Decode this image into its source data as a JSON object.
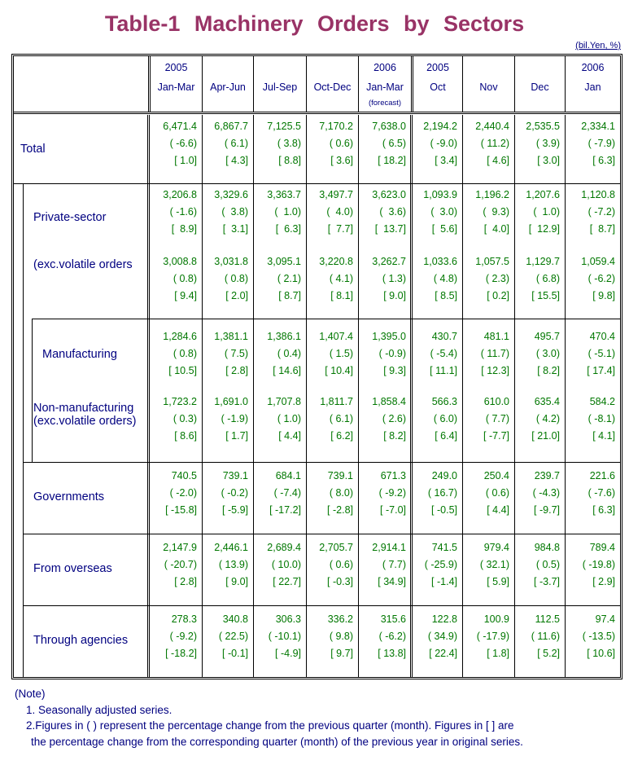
{
  "title": "Table-1  Machinery  Orders  by  Sectors",
  "unit": "(bil.Yen, %)",
  "columns": [
    {
      "year": "2005",
      "period": "Jan-Mar",
      "note": ""
    },
    {
      "year": "",
      "period": "Apr-Jun",
      "note": ""
    },
    {
      "year": "",
      "period": "Jul-Sep",
      "note": ""
    },
    {
      "year": "",
      "period": "Oct-Dec",
      "note": ""
    },
    {
      "year": "2006",
      "period": "Jan-Mar",
      "note": "(forecast)"
    },
    {
      "year": "2005",
      "period": "Oct",
      "note": ""
    },
    {
      "year": "",
      "period": "Nov",
      "note": ""
    },
    {
      "year": "",
      "period": "Dec",
      "note": ""
    },
    {
      "year": "2006",
      "period": "Jan",
      "note": ""
    }
  ],
  "rows": [
    {
      "label": "Total",
      "values": [
        "6,471.4",
        "6,867.7",
        "7,125.5",
        "7,170.2",
        "7,638.0",
        "2,194.2",
        "2,440.4",
        "2,535.5",
        "2,334.1"
      ],
      "qoq": [
        "( -6.6)",
        "( 6.1)",
        "( 3.8)",
        "( 0.6)",
        "( 6.5)",
        "( -9.0)",
        "( 11.2)",
        "( 3.9)",
        "( -7.9)"
      ],
      "yoy": [
        "[ 1.0]",
        "[ 4.3]",
        "[ 8.8]",
        "[ 3.6]",
        "[ 18.2]",
        "[ 3.4]",
        "[ 4.6]",
        "[ 3.0]",
        "[ 6.3]"
      ]
    },
    {
      "label": "Private-sector",
      "values": [
        "3,206.8",
        "3,329.6",
        "3,363.7",
        "3,497.7",
        "3,623.0",
        "1,093.9",
        "1,196.2",
        "1,207.6",
        "1,120.8"
      ],
      "qoq": [
        "( -1.6)",
        "(  3.8)",
        "(  1.0)",
        "(  4.0)",
        "(  3.6)",
        "(  3.0)",
        "(  9.3)",
        "(  1.0)",
        "( -7.2)"
      ],
      "yoy": [
        "[  8.9]",
        "[  3.1]",
        "[  6.3]",
        "[  7.7]",
        "[  13.7]",
        "[  5.6]",
        "[  4.0]",
        "[  12.9]",
        "[  8.7]"
      ]
    },
    {
      "label": "(exc.volatile orders",
      "values": [
        "3,008.8",
        "3,031.8",
        "3,095.1",
        "3,220.8",
        "3,262.7",
        "1,033.6",
        "1,057.5",
        "1,129.7",
        "1,059.4"
      ],
      "qoq": [
        "( 0.8)",
        "( 0.8)",
        "( 2.1)",
        "( 4.1)",
        "( 1.3)",
        "( 4.8)",
        "( 2.3)",
        "( 6.8)",
        "( -6.2)"
      ],
      "yoy": [
        "[ 9.4]",
        "[ 2.0]",
        "[ 8.7]",
        "[ 8.1]",
        "[ 9.0]",
        "[ 8.5]",
        "[ 0.2]",
        "[ 15.5]",
        "[ 9.8]"
      ]
    },
    {
      "label": "Manufacturing",
      "values": [
        "1,284.6",
        "1,381.1",
        "1,386.1",
        "1,407.4",
        "1,395.0",
        "430.7",
        "481.1",
        "495.7",
        "470.4"
      ],
      "qoq": [
        "( 0.8)",
        "( 7.5)",
        "( 0.4)",
        "( 1.5)",
        "( -0.9)",
        "( -5.4)",
        "( 11.7)",
        "( 3.0)",
        "( -5.1)"
      ],
      "yoy": [
        "[ 10.5]",
        "[ 2.8]",
        "[ 14.6]",
        "[ 10.4]",
        "[ 9.3]",
        "[ 11.1]",
        "[ 12.3]",
        "[ 8.2]",
        "[ 17.4]"
      ]
    },
    {
      "label": "Non-manufacturing",
      "label2": "(exc.volatile orders)",
      "values": [
        "1,723.2",
        "1,691.0",
        "1,707.8",
        "1,811.7",
        "1,858.4",
        "566.3",
        "610.0",
        "635.4",
        "584.2"
      ],
      "qoq": [
        "( 0.3)",
        "( -1.9)",
        "( 1.0)",
        "( 6.1)",
        "( 2.6)",
        "( 6.0)",
        "( 7.7)",
        "( 4.2)",
        "( -8.1)"
      ],
      "yoy": [
        "[ 8.6]",
        "[ 1.7]",
        "[ 4.4]",
        "[ 6.2]",
        "[ 8.2]",
        "[ 6.4]",
        "[ -7.7]",
        "[ 21.0]",
        "[ 4.1]"
      ]
    },
    {
      "label": "Governments",
      "values": [
        "740.5",
        "739.1",
        "684.1",
        "739.1",
        "671.3",
        "249.0",
        "250.4",
        "239.7",
        "221.6"
      ],
      "qoq": [
        "( -2.0)",
        "( -0.2)",
        "( -7.4)",
        "( 8.0)",
        "( -9.2)",
        "( 16.7)",
        "( 0.6)",
        "( -4.3)",
        "( -7.6)"
      ],
      "yoy": [
        "[ -15.8]",
        "[ -5.9]",
        "[ -17.2]",
        "[ -2.8]",
        "[ -7.0]",
        "[ -0.5]",
        "[ 4.4]",
        "[ -9.7]",
        "[ 6.3]"
      ]
    },
    {
      "label": "From overseas",
      "values": [
        "2,147.9",
        "2,446.1",
        "2,689.4",
        "2,705.7",
        "2,914.1",
        "741.5",
        "979.4",
        "984.8",
        "789.4"
      ],
      "qoq": [
        "( -20.7)",
        "( 13.9)",
        "( 10.0)",
        "( 0.6)",
        "( 7.7)",
        "( -25.9)",
        "( 32.1)",
        "( 0.5)",
        "( -19.8)"
      ],
      "yoy": [
        "[ 2.8]",
        "[ 9.0]",
        "[ 22.7]",
        "[ -0.3]",
        "[ 34.9]",
        "[ -1.4]",
        "[ 5.9]",
        "[ -3.7]",
        "[ 2.9]"
      ]
    },
    {
      "label": "Through agencies",
      "values": [
        "278.3",
        "340.8",
        "306.3",
        "336.2",
        "315.6",
        "122.8",
        "100.9",
        "112.5",
        "97.4"
      ],
      "qoq": [
        "( -9.2)",
        "( 22.5)",
        "( -10.1)",
        "( 9.8)",
        "( -6.2)",
        "( 34.9)",
        "( -17.9)",
        "( 11.6)",
        "( -13.5)"
      ],
      "yoy": [
        "[ -18.2]",
        "[ -0.1]",
        "[ -4.9]",
        "[ 9.7]",
        "[ 13.8]",
        "[ 22.4]",
        "[ 1.8]",
        "[ 5.2]",
        "[ 10.6]"
      ]
    }
  ],
  "notes": {
    "heading": "(Note)",
    "items": [
      "1. Seasonally adjusted series.",
      "2.Figures in ( ) represent the percentage change from the previous quarter (month). Figures in [ ] are",
      "the percentage change from the corresponding quarter (month) of the previous year in original series."
    ]
  }
}
